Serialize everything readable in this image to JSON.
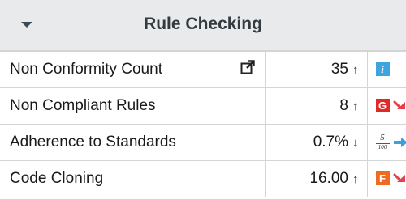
{
  "widget": {
    "title": "Rule Checking"
  },
  "rows": [
    {
      "name": "Non Conformity Count",
      "value": "35",
      "arrow": "↑",
      "icons": [
        "info-icon"
      ]
    },
    {
      "name": "Non Compliant Rules",
      "value": "8",
      "arrow": "↑",
      "icon_letter": "G",
      "icons": [
        "grade-g-icon",
        "trend-down-red-icon"
      ]
    },
    {
      "name": "Adherence to Standards",
      "value": "0.7%",
      "arrow": "↓",
      "fraction": {
        "numerator": "5",
        "denominator": "100"
      },
      "icons": [
        "fraction-score-icon",
        "trend-flat-blue-icon"
      ]
    },
    {
      "name": "Code Cloning",
      "value": "16.00",
      "arrow": "↑",
      "icon_letter": "F",
      "icons": [
        "grade-f-icon",
        "trend-down-red-icon"
      ]
    }
  ],
  "icons": {
    "info": "i",
    "external_link": "external-link-icon",
    "collapse": "chevron-down-icon"
  },
  "colors": {
    "header_bg": "#e9eaeb",
    "info_blue": "#3da4e0",
    "grade_red": "#e02a2a",
    "grade_orange": "#f06b1f",
    "trend_red": "#e8404a",
    "trend_blue": "#3aa0e0"
  }
}
